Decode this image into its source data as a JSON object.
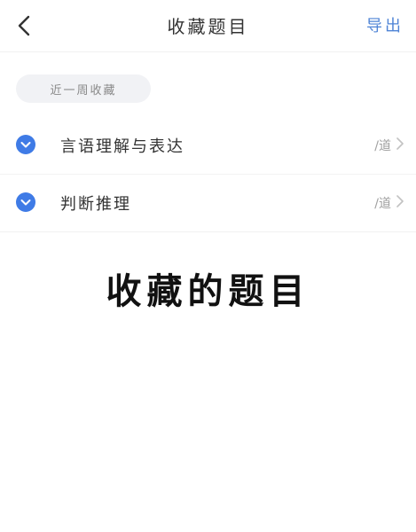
{
  "header": {
    "title": "收藏题目",
    "export_label": "导出"
  },
  "filter": {
    "label": "近一周收藏"
  },
  "categories": [
    {
      "label": "言语理解与表达",
      "count": "/道"
    },
    {
      "label": "判断推理",
      "count": "/道"
    }
  ],
  "caption": "收藏的题目",
  "colors": {
    "accent": "#3f7be6",
    "export_text": "#4f84d6",
    "chip_bg": "#f1f2f5"
  },
  "icons": {
    "back": "chevron-left-icon",
    "check": "check-circle-icon",
    "row_arrow": "chevron-right-icon"
  }
}
